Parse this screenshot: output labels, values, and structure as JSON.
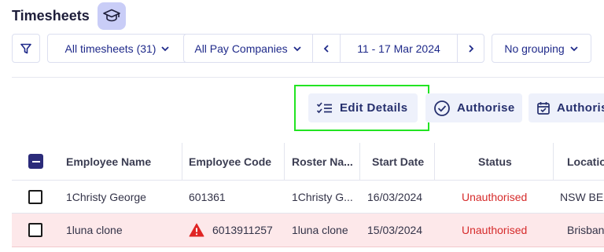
{
  "header": {
    "title": "Timesheets",
    "cap_icon": "graduation-cap-icon"
  },
  "filters": {
    "filter_icon": "filter-icon",
    "timesheets": "All timesheets (31)",
    "pay_companies": "All Pay Companies",
    "date_range": "11 - 17 Mar 2024",
    "grouping": "No grouping"
  },
  "actions": {
    "edit_details": "Edit Details",
    "authorise": "Authorise",
    "authorise_partial": "Authoris"
  },
  "table": {
    "columns": [
      "Employee Name",
      "Employee Code",
      "Roster Na...",
      "Start Date",
      "Status",
      "Locatio"
    ],
    "rows": [
      {
        "name": "1Christy George",
        "code": "601361",
        "roster": "1Christy G...",
        "start": "16/03/2024",
        "status": "Unauthorised",
        "location": "NSW BEI",
        "warning": false
      },
      {
        "name": "1luna clone",
        "code": "6013911257",
        "roster": "1luna clone",
        "start": "15/03/2024",
        "status": "Unauthorised",
        "location": "Brisban",
        "warning": true
      }
    ]
  },
  "colors": {
    "accent": "#1f2a8a",
    "status_error": "#d62b2b",
    "highlight": "#22e422",
    "warning_row": "#fde8ea"
  }
}
